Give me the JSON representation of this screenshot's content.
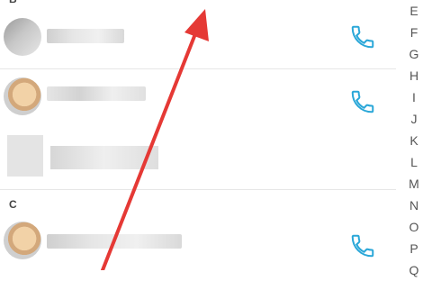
{
  "sections": [
    {
      "letter": "B"
    },
    {
      "letter": "C"
    }
  ],
  "contacts": [
    {
      "icon": "phone-icon"
    },
    {
      "icon": "phone-icon"
    },
    {
      "icon": "phone-icon"
    }
  ],
  "index_letters": [
    "E",
    "F",
    "G",
    "H",
    "I",
    "J",
    "K",
    "L",
    "M",
    "N",
    "O",
    "P",
    "Q"
  ],
  "colors": {
    "accent": "#2aa7d8",
    "arrow": "#e53935",
    "divider": "#e6e6e6"
  }
}
